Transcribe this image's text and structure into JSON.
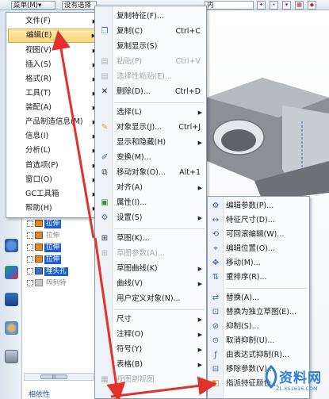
{
  "toolbar": {
    "menu_button": "菜单(M)▾",
    "filter_select": "没有选择",
    "scope_select": "内"
  },
  "main_menu": {
    "items": [
      {
        "label": "文件(F)",
        "submenu": true
      },
      {
        "label": "编辑(E)",
        "submenu": true,
        "active": true
      },
      {
        "label": "视图(V)",
        "submenu": true
      },
      {
        "label": "插入(S)",
        "submenu": true
      },
      {
        "label": "格式(R)",
        "submenu": true
      },
      {
        "label": "工具(T)",
        "submenu": true
      },
      {
        "label": "装配(A)",
        "submenu": true
      },
      {
        "label": "产品制造信息(M)",
        "submenu": true
      },
      {
        "label": "信息(I)",
        "submenu": true
      },
      {
        "label": "分析(L)",
        "submenu": true
      },
      {
        "label": "首选项(P)",
        "submenu": true
      },
      {
        "label": "窗口(O)",
        "submenu": true
      },
      {
        "label": "GC工具箱",
        "submenu": true
      },
      {
        "label": "帮助(H)",
        "submenu": true
      }
    ]
  },
  "edit_menu": {
    "items": [
      {
        "label": "复制特征(F)...",
        "shortcut": "",
        "disabled": false
      },
      {
        "label": "复制(C)",
        "shortcut": "Ctrl+C",
        "disabled": false
      },
      {
        "label": "复制显示(S)",
        "shortcut": "",
        "disabled": false
      },
      {
        "label": "粘贴(P)",
        "shortcut": "Ctrl+V",
        "disabled": true
      },
      {
        "label": "选择性粘贴(E)...",
        "shortcut": "",
        "disabled": true
      },
      {
        "label": "删除(D)...",
        "shortcut": "Ctrl+D",
        "disabled": false
      },
      {
        "label": "选择(L)",
        "shortcut": "",
        "disabled": false,
        "submenu": true
      },
      {
        "label": "对象显示(J)...",
        "shortcut": "Ctrl+J",
        "disabled": false
      },
      {
        "label": "显示和隐藏(H)",
        "shortcut": "",
        "disabled": false,
        "submenu": true
      },
      {
        "label": "变换(M)...",
        "shortcut": "",
        "disabled": false
      },
      {
        "label": "移动对象(O)...",
        "shortcut": "Alt+1",
        "disabled": false
      },
      {
        "label": "对齐(A)",
        "shortcut": "",
        "disabled": false,
        "submenu": true
      },
      {
        "label": "属性(I)...",
        "shortcut": "",
        "disabled": false
      },
      {
        "label": "设置(S)",
        "shortcut": "",
        "disabled": false,
        "submenu": true
      },
      {
        "label": "草图(K)...",
        "shortcut": "",
        "disabled": false
      },
      {
        "label": "草图参数(A)...",
        "shortcut": "",
        "disabled": true
      },
      {
        "label": "草图曲线(K)",
        "shortcut": "",
        "disabled": false,
        "submenu": true
      },
      {
        "label": "曲线(V)",
        "shortcut": "",
        "disabled": false,
        "submenu": true
      },
      {
        "label": "用户定义对象(N)...",
        "shortcut": "",
        "disabled": false
      },
      {
        "label": "尺寸",
        "shortcut": "",
        "disabled": false,
        "submenu": true
      },
      {
        "label": "注释(O)",
        "shortcut": "",
        "disabled": false,
        "submenu": true
      },
      {
        "label": "符号(Y)",
        "shortcut": "",
        "disabled": false,
        "submenu": true
      },
      {
        "label": "表格(B)",
        "shortcut": "",
        "disabled": false,
        "submenu": true
      },
      {
        "label": "视图剖视图",
        "shortcut": "",
        "disabled": true
      }
    ]
  },
  "object_menu": {
    "items": [
      {
        "label": "编辑参数(P)..."
      },
      {
        "label": "特征尺寸(D)..."
      },
      {
        "label": "可回滚编辑(W)..."
      },
      {
        "label": "编辑位置(O)..."
      },
      {
        "label": "移动(M)..."
      },
      {
        "label": "重排序(R)..."
      },
      {
        "label": "替换(A)..."
      },
      {
        "label": "替换为独立草图(E)..."
      },
      {
        "label": "抑制(S)..."
      },
      {
        "label": "取消抑制(U)..."
      },
      {
        "label": "由表达式抑制(R)..."
      },
      {
        "label": "移除参数(V)..."
      },
      {
        "label": "指派特征颜色..."
      }
    ]
  },
  "tree": {
    "items": [
      {
        "label": "拉伸",
        "faded": false
      },
      {
        "label": "拉伸",
        "faded": true
      },
      {
        "label": "拉伸",
        "faded": false
      },
      {
        "label": "拉伸",
        "faded": false
      },
      {
        "label": "埋头孔",
        "faded": false
      },
      {
        "label": "阵列特",
        "faded": true
      }
    ],
    "bottom_tab": "相依性"
  },
  "watermark": {
    "text": "资料网",
    "url": "ZL.XS1616.COM"
  },
  "colors": {
    "highlight": "#f7d778",
    "arrow_red": "#e2312b",
    "selection_blue": "#1e5fd6"
  }
}
